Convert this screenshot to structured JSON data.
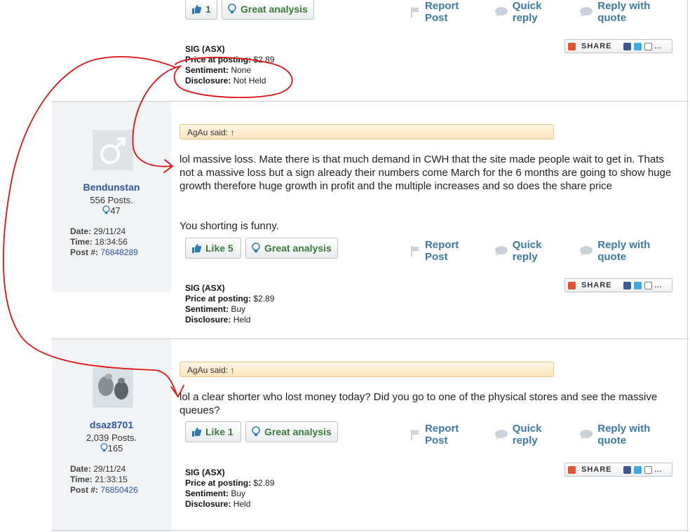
{
  "top_post": {
    "like_label": "1",
    "great_label": "Great analysis",
    "actions": [
      "Report Post",
      "Quick reply",
      "Reply with quote"
    ],
    "sig": {
      "ticker": "SIG (ASX)",
      "price_label": "Price at posting:",
      "price": "$2.89",
      "sent_label": "Sentiment:",
      "sentiment": "None",
      "disc_label": "Disclosure:",
      "disclosure": "Not Held"
    },
    "share_label": "SHARE"
  },
  "post2": {
    "username": "Bendunstan",
    "posts": "556 Posts.",
    "likes": "47",
    "date_label": "Date:",
    "date": "29/11/24",
    "time_label": "Time:",
    "time": "18:34:56",
    "postno_label": "Post #:",
    "postno": "76848289",
    "quote": "AgAu said: ↑",
    "text1": "lol massive loss. Mate there is that much demand in CWH that the site made people wait to get in. Thats not a massive loss but a sign already their numbers come March for the 6 months are going to show huge growth therefore huge growth in profit and the multiple increases and so does the share price",
    "text2": "You shorting is funny.",
    "like_label": "Like 5",
    "great_label": "Great analysis",
    "actions": [
      "Report Post",
      "Quick reply",
      "Reply with quote"
    ],
    "sig": {
      "ticker": "SIG (ASX)",
      "price_label": "Price at posting:",
      "price": "$2.89",
      "sent_label": "Sentiment:",
      "sentiment": "Buy",
      "disc_label": "Disclosure:",
      "disclosure": "Held"
    },
    "share_label": "SHARE"
  },
  "post3": {
    "username": "dsaz8701",
    "posts": "2,039 Posts.",
    "likes": "165",
    "date_label": "Date:",
    "date": "29/11/24",
    "time_label": "Time:",
    "time": "21:33:15",
    "postno_label": "Post #:",
    "postno": "76850426",
    "quote": "AgAu said: ↑",
    "text1": "lol a clear shorter who lost money today? Did you go to one of the physical stores and see the massive queues?",
    "like_label": "Like 1",
    "great_label": "Great analysis",
    "actions": [
      "Report Post",
      "Quick reply",
      "Reply with quote"
    ],
    "sig": {
      "ticker": "SIG (ASX)",
      "price_label": "Price at posting:",
      "price": "$2.89",
      "sent_label": "Sentiment:",
      "sentiment": "Buy",
      "disc_label": "Disclosure:",
      "disclosure": "Held"
    },
    "share_label": "SHARE"
  },
  "colors": {
    "link_blue": "#3b79a3",
    "username_blue": "#2a54a6",
    "green_button_text": "#3a7a3a",
    "annotation_red": "#e01010",
    "quote_bg": "#fde4bd"
  }
}
